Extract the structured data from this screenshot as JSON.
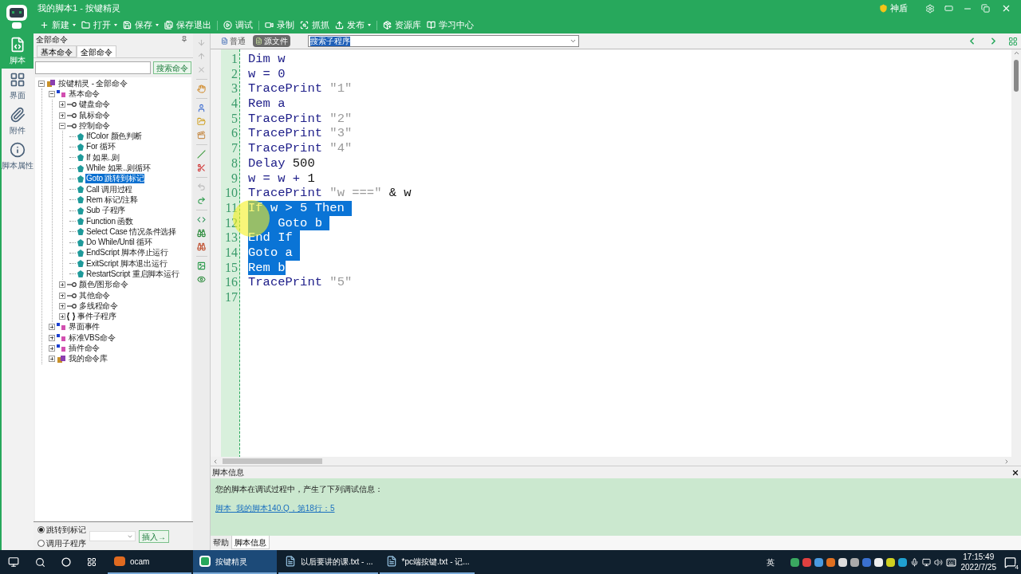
{
  "window": {
    "title": "我的脚本1 - 按键精灵",
    "shield_label": "神盾"
  },
  "toolbar": [
    {
      "label": "新建",
      "dropdown": true
    },
    {
      "label": "打开",
      "dropdown": true
    },
    {
      "label": "保存",
      "dropdown": true
    },
    {
      "label": "保存退出",
      "dropdown": false
    },
    {
      "label": "调试",
      "dropdown": false
    },
    {
      "label": "录制",
      "dropdown": false
    },
    {
      "label": "抓抓",
      "dropdown": false
    },
    {
      "label": "发布",
      "dropdown": true
    },
    {
      "label": "资源库",
      "dropdown": false
    },
    {
      "label": "学习中心",
      "dropdown": false
    }
  ],
  "nav": [
    {
      "label": "脚本",
      "selected": true
    },
    {
      "label": "界面",
      "selected": false
    },
    {
      "label": "附件",
      "selected": false
    },
    {
      "label": "脚本属性",
      "selected": false
    }
  ],
  "commands": {
    "title": "全部命令",
    "tabs": [
      {
        "label": "基本命令",
        "selected": false
      },
      {
        "label": "全部命令",
        "selected": true
      }
    ],
    "search_button": "搜索命令",
    "tree": [
      {
        "label": "按键精灵 - 全部命令",
        "kind": "root",
        "expanded": true,
        "selected": false,
        "children": [
          {
            "label": "基本命令",
            "kind": "group",
            "expanded": true,
            "selected": false,
            "children": [
              {
                "label": "键盘命令",
                "kind": "key",
                "expanded": false,
                "selected": false
              },
              {
                "label": "鼠标命令",
                "kind": "key",
                "expanded": false,
                "selected": false
              },
              {
                "label": "控制命令",
                "kind": "key",
                "expanded": true,
                "selected": false,
                "children": [
                  {
                    "label": "IfColor 颜色判断",
                    "kind": "leaf",
                    "selected": false
                  },
                  {
                    "label": "For 循环",
                    "kind": "leaf",
                    "selected": false
                  },
                  {
                    "label": "If 如果..则",
                    "kind": "leaf",
                    "selected": false
                  },
                  {
                    "label": "While 如果..则循环",
                    "kind": "leaf",
                    "selected": false
                  },
                  {
                    "label": "Goto 跳转到标记",
                    "kind": "leaf",
                    "selected": true
                  },
                  {
                    "label": "Call 调用过程",
                    "kind": "leaf",
                    "selected": false
                  },
                  {
                    "label": "Rem 标记/注释",
                    "kind": "leaf",
                    "selected": false
                  },
                  {
                    "label": "Sub 子程序",
                    "kind": "leaf",
                    "selected": false
                  },
                  {
                    "label": "Function 函数",
                    "kind": "leaf",
                    "selected": false
                  },
                  {
                    "label": "Select Case 情况条件选择",
                    "kind": "leaf",
                    "selected": false
                  },
                  {
                    "label": "Do While/Until 循环",
                    "kind": "leaf",
                    "selected": false
                  },
                  {
                    "label": "EndScript 脚本停止运行",
                    "kind": "leaf",
                    "selected": false
                  },
                  {
                    "label": "ExitScript 脚本退出运行",
                    "kind": "leaf",
                    "selected": false
                  },
                  {
                    "label": "RestartScript 重启脚本运行",
                    "kind": "leaf",
                    "selected": false
                  }
                ]
              },
              {
                "label": "颜色/图形命令",
                "kind": "key",
                "expanded": false,
                "selected": false
              },
              {
                "label": "其他命令",
                "kind": "key",
                "expanded": false,
                "selected": false
              },
              {
                "label": "多线程命令",
                "kind": "key",
                "expanded": false,
                "selected": false
              },
              {
                "label": "事件子程序",
                "kind": "braces",
                "expanded": false,
                "selected": false
              }
            ]
          },
          {
            "label": "界面事件",
            "kind": "group",
            "expanded": false,
            "selected": false
          },
          {
            "label": "标准VBS命令",
            "kind": "group",
            "expanded": false,
            "selected": false
          },
          {
            "label": "插件命令",
            "kind": "group",
            "expanded": false,
            "selected": false
          },
          {
            "label": "我的命令库",
            "kind": "root",
            "expanded": false,
            "selected": false
          }
        ]
      }
    ],
    "options": [
      {
        "label": "跳转到标记",
        "selected": true
      },
      {
        "label": "调用子程序",
        "selected": false
      }
    ],
    "insert_button": "插入→"
  },
  "editor": {
    "view_tabs": [
      {
        "label": "普通",
        "selected": false
      },
      {
        "label": "源文件",
        "selected": true
      }
    ],
    "sub_search": "搜索子程序",
    "lines": [
      {
        "number": "1",
        "selected": false,
        "segments": [
          {
            "text": "Dim w",
            "kind": "kw"
          }
        ]
      },
      {
        "number": "2",
        "selected": false,
        "segments": [
          {
            "text": "w = 0",
            "kind": "kw"
          }
        ]
      },
      {
        "number": "3",
        "selected": false,
        "segments": [
          {
            "text": "TracePrint ",
            "kind": "kw"
          },
          {
            "text": "\"1\"",
            "kind": "str"
          }
        ]
      },
      {
        "number": "4",
        "selected": false,
        "segments": [
          {
            "text": "Rem a",
            "kind": "kw"
          }
        ]
      },
      {
        "number": "5",
        "selected": false,
        "segments": [
          {
            "text": "TracePrint ",
            "kind": "kw"
          },
          {
            "text": "\"2\"",
            "kind": "str"
          }
        ]
      },
      {
        "number": "6",
        "selected": false,
        "segments": [
          {
            "text": "TracePrint ",
            "kind": "kw"
          },
          {
            "text": "\"3\"",
            "kind": "str"
          }
        ]
      },
      {
        "number": "7",
        "selected": false,
        "segments": [
          {
            "text": "TracePrint ",
            "kind": "kw"
          },
          {
            "text": "\"4\"",
            "kind": "str"
          }
        ]
      },
      {
        "number": "8",
        "selected": false,
        "segments": [
          {
            "text": "Delay ",
            "kind": "kw"
          },
          {
            "text": "500",
            "kind": "num"
          }
        ]
      },
      {
        "number": "9",
        "selected": false,
        "segments": [
          {
            "text": "w = w + ",
            "kind": "kw"
          },
          {
            "text": "1",
            "kind": "num"
          }
        ]
      },
      {
        "number": "10",
        "selected": false,
        "segments": [
          {
            "text": "TracePrint ",
            "kind": "kw"
          },
          {
            "text": "\"w ===\"",
            "kind": "str"
          },
          {
            "text": " & w",
            "kind": "num"
          }
        ]
      },
      {
        "number": "11",
        "selected": true,
        "segments": [
          {
            "text": "If w > 5 Then ",
            "kind": "kw"
          }
        ]
      },
      {
        "number": "12",
        "selected": true,
        "segments": [
          {
            "text": "    Goto b ",
            "kind": "kw"
          }
        ]
      },
      {
        "number": "13",
        "selected": true,
        "segments": [
          {
            "text": "End If ",
            "kind": "kw"
          }
        ]
      },
      {
        "number": "14",
        "selected": true,
        "segments": [
          {
            "text": "Goto a ",
            "kind": "kw"
          }
        ]
      },
      {
        "number": "15",
        "selected": true,
        "segments": [
          {
            "text": "Rem b",
            "kind": "kw"
          }
        ]
      },
      {
        "number": "16",
        "selected": false,
        "segments": [
          {
            "text": "TracePrint ",
            "kind": "kw"
          },
          {
            "text": "\"5\"",
            "kind": "str"
          }
        ]
      },
      {
        "number": "17"
      }
    ]
  },
  "info_panel": {
    "title": "脚本信息",
    "message": "您的脚本在调试过程中，产生了下列调试信息：",
    "link": "脚本_我的脚本140.Q，第18行：5",
    "tabs": [
      {
        "label": "帮助",
        "selected": false
      },
      {
        "label": "脚本信息",
        "selected": true
      }
    ]
  },
  "taskbar": {
    "apps": [
      {
        "label": "ocam",
        "kind": "ocam",
        "selected": false
      },
      {
        "label": "按键精灵",
        "kind": "anjian",
        "selected": true
      },
      {
        "label": "以后要讲的课.txt - ...",
        "kind": "notepad",
        "selected": false
      },
      {
        "label": "*pc端按键.txt - 记...",
        "kind": "notepad",
        "selected": false
      }
    ],
    "ime": "英",
    "time": "17:15:49",
    "date": "2022/7/25",
    "notifications": "4"
  }
}
